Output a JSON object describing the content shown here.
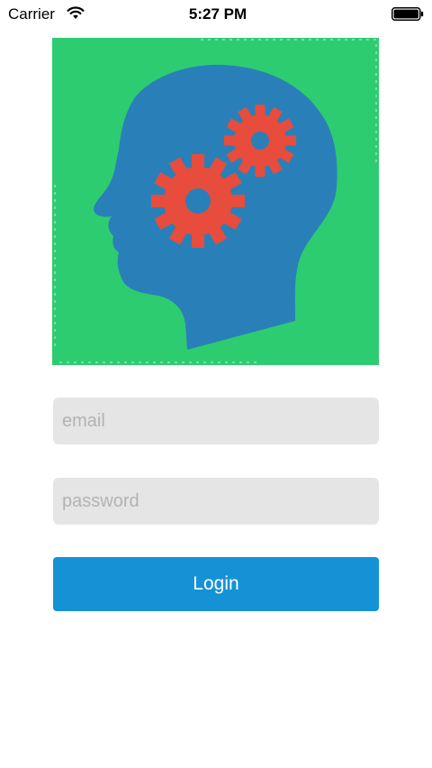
{
  "status_bar": {
    "carrier": "Carrier",
    "time": "5:27 PM",
    "wifi_icon": "wifi-icon",
    "battery_icon": "battery-full-icon"
  },
  "logo": {
    "icon": "head-with-gears-icon",
    "colors": {
      "background": "#2ecc71",
      "head": "#2980b9",
      "gears": "#e74c3c"
    }
  },
  "form": {
    "email_placeholder": "email",
    "email_value": "",
    "password_placeholder": "password",
    "password_value": "",
    "login_label": "Login",
    "login_color": "#1592d6"
  }
}
